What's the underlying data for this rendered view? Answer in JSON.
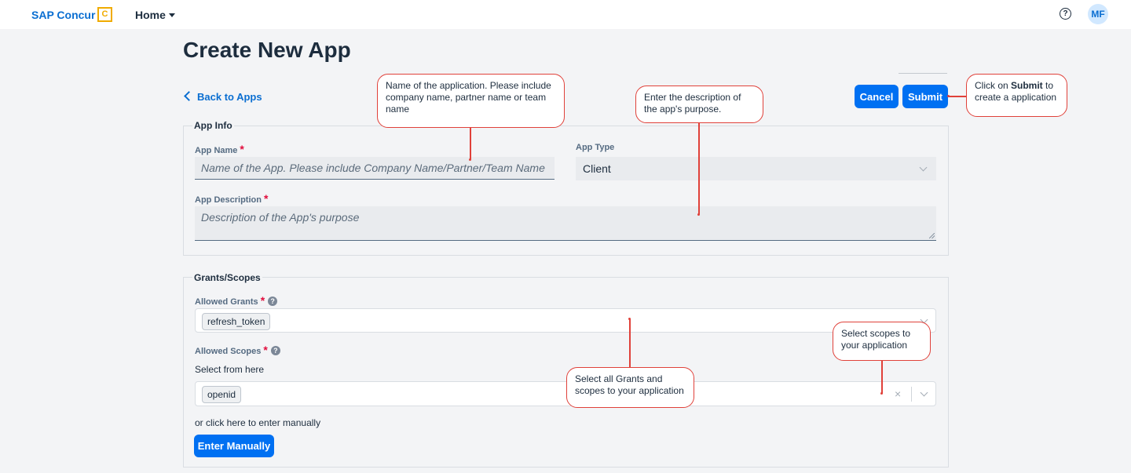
{
  "topbar": {
    "brand": "SAP Concur",
    "brand_mark": "C",
    "home_label": "Home",
    "help_glyph": "?",
    "avatar_initials": "MF"
  },
  "page": {
    "title": "Create New App",
    "back_label": "Back to Apps"
  },
  "actions": {
    "cancel_label": "Cancel",
    "submit_label": "Submit"
  },
  "app_info": {
    "legend": "App Info",
    "name_label": "App Name",
    "name_placeholder": "Name of the App. Please include Company Name/Partner/Team Name",
    "type_label": "App Type",
    "type_value": "Client",
    "desc_label": "App Description",
    "desc_placeholder": "Description of the App's purpose",
    "required_mark": "*"
  },
  "grants": {
    "legend": "Grants/Scopes",
    "grants_label": "Allowed Grants",
    "grants_chip": "refresh_token",
    "scopes_label": "Allowed Scopes",
    "select_hint": "Select from here",
    "scopes_chip": "openid",
    "clear_glyph": "×",
    "manual_hint": "or click here to enter manually",
    "manual_button": "Enter Manually",
    "info_glyph": "?"
  },
  "callouts": {
    "name": "Name of the application. Please include company name, partner name or team name",
    "desc": "Enter the description of the app's purpose.",
    "submit_pre": "Click on ",
    "submit_bold": "Submit",
    "submit_post": " to create a application",
    "scopes": "Select scopes to your application",
    "grants": "Select all Grants and scopes to your application"
  },
  "colors": {
    "accent": "#0070f2",
    "brand": "#0a6ed1",
    "logo": "#f0ab00",
    "required": "#e10c3c",
    "callout_border": "#e0413a"
  },
  "icons": [
    "chevron-down-icon",
    "help-circle-icon",
    "back-chevron-icon",
    "info-circle-icon",
    "clear-icon",
    "resize-grip-icon"
  ]
}
